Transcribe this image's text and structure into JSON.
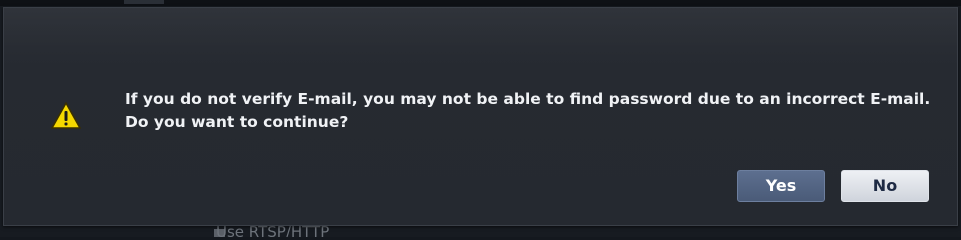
{
  "background": {
    "partial_label": "Use RTSP/HTTP"
  },
  "dialog": {
    "icon": "warning-triangle-icon",
    "message_line1": "If you do not verify E-mail, you may not be able to find password due to an incorrect E-mail.",
    "message_line2": "Do you want to continue?",
    "yes_label": "Yes",
    "no_label": "No"
  },
  "colors": {
    "dialog_background": "#262a31",
    "text": "#f0f2f5",
    "yes_button": "#4f6180",
    "no_button": "#e2e6ec",
    "warning_yellow": "#f5d800"
  }
}
